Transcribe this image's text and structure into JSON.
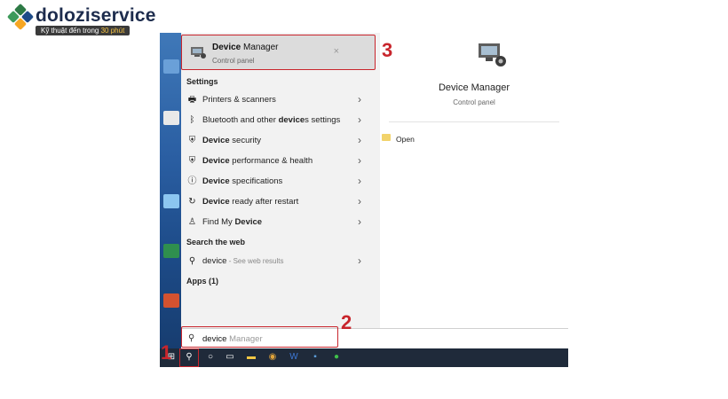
{
  "logo": {
    "name": "doloziservice",
    "tagline_pre": "Kỹ thuật đến trong ",
    "tagline_highlight": "30 phút"
  },
  "top_result": {
    "title_bold": "Device",
    "title_rest": " Manager",
    "subtitle": "Control panel",
    "close_glyph": "×"
  },
  "sections": {
    "settings": "Settings",
    "web": "Search the web",
    "apps": "Apps (1)"
  },
  "settings_items": [
    {
      "icon": "printer-icon",
      "glyph": "🖶",
      "pre": "Printers & scanners",
      "bold": "",
      "post": ""
    },
    {
      "icon": "bluetooth-icon",
      "glyph": "ᛒ",
      "pre": "Bluetooth and other ",
      "bold": "device",
      "post": "s settings"
    },
    {
      "icon": "shield-icon",
      "glyph": "⛨",
      "pre": "",
      "bold": "Device",
      "post": " security"
    },
    {
      "icon": "shield-icon",
      "glyph": "⛨",
      "pre": "",
      "bold": "Device",
      "post": " performance & health"
    },
    {
      "icon": "info-icon",
      "glyph": "ⓘ",
      "pre": "",
      "bold": "Device",
      "post": " specifications"
    },
    {
      "icon": "refresh-icon",
      "glyph": "↻",
      "pre": "",
      "bold": "Device",
      "post": " ready after restart"
    },
    {
      "icon": "person-icon",
      "glyph": "♙",
      "pre": "Find My ",
      "bold": "Device",
      "post": ""
    }
  ],
  "web_item": {
    "icon": "search-icon",
    "glyph": "⚲",
    "text": "device",
    "muted": " - See web results"
  },
  "detail": {
    "title": "Device Manager",
    "subtitle": "Control panel",
    "open_label": "Open"
  },
  "search": {
    "typed": "device",
    "ghost": " Manager"
  },
  "chevron": "›",
  "steps": {
    "one": "1",
    "two": "2",
    "three": "3"
  }
}
